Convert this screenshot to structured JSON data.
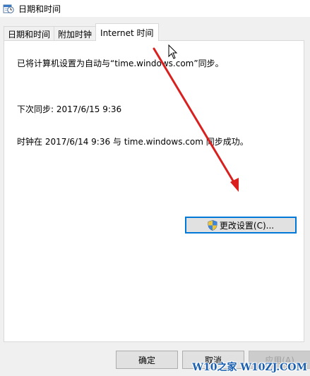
{
  "window": {
    "title": "日期和时间",
    "title_icon": "clock-calendar-icon"
  },
  "tabs": [
    {
      "label": "日期和时间",
      "active": false
    },
    {
      "label": "附加时钟",
      "active": false
    },
    {
      "label": "Internet 时间",
      "active": true
    }
  ],
  "panel": {
    "sync_status": "已将计算机设置为自动与“time.windows.com”同步。",
    "next_sync": "下次同步: 2017/6/15 9:36",
    "last_sync": "时钟在 2017/6/14 9:36 与 time.windows.com 同步成功。",
    "change_settings_label": "更改设置(C)...",
    "change_settings_icon": "uac-shield-icon"
  },
  "footer": {
    "ok_label": "确定",
    "cancel_label": "取消",
    "apply_label": "应用(A)"
  },
  "watermark": "W10之家 W10ZJ.COM",
  "annotation": {
    "arrow_color": "#d9201e",
    "cursor": "mouse-pointer-icon"
  },
  "colors": {
    "accent": "#0078d7",
    "panel_bg": "#ffffff",
    "window_bg": "#f0f0f0"
  }
}
